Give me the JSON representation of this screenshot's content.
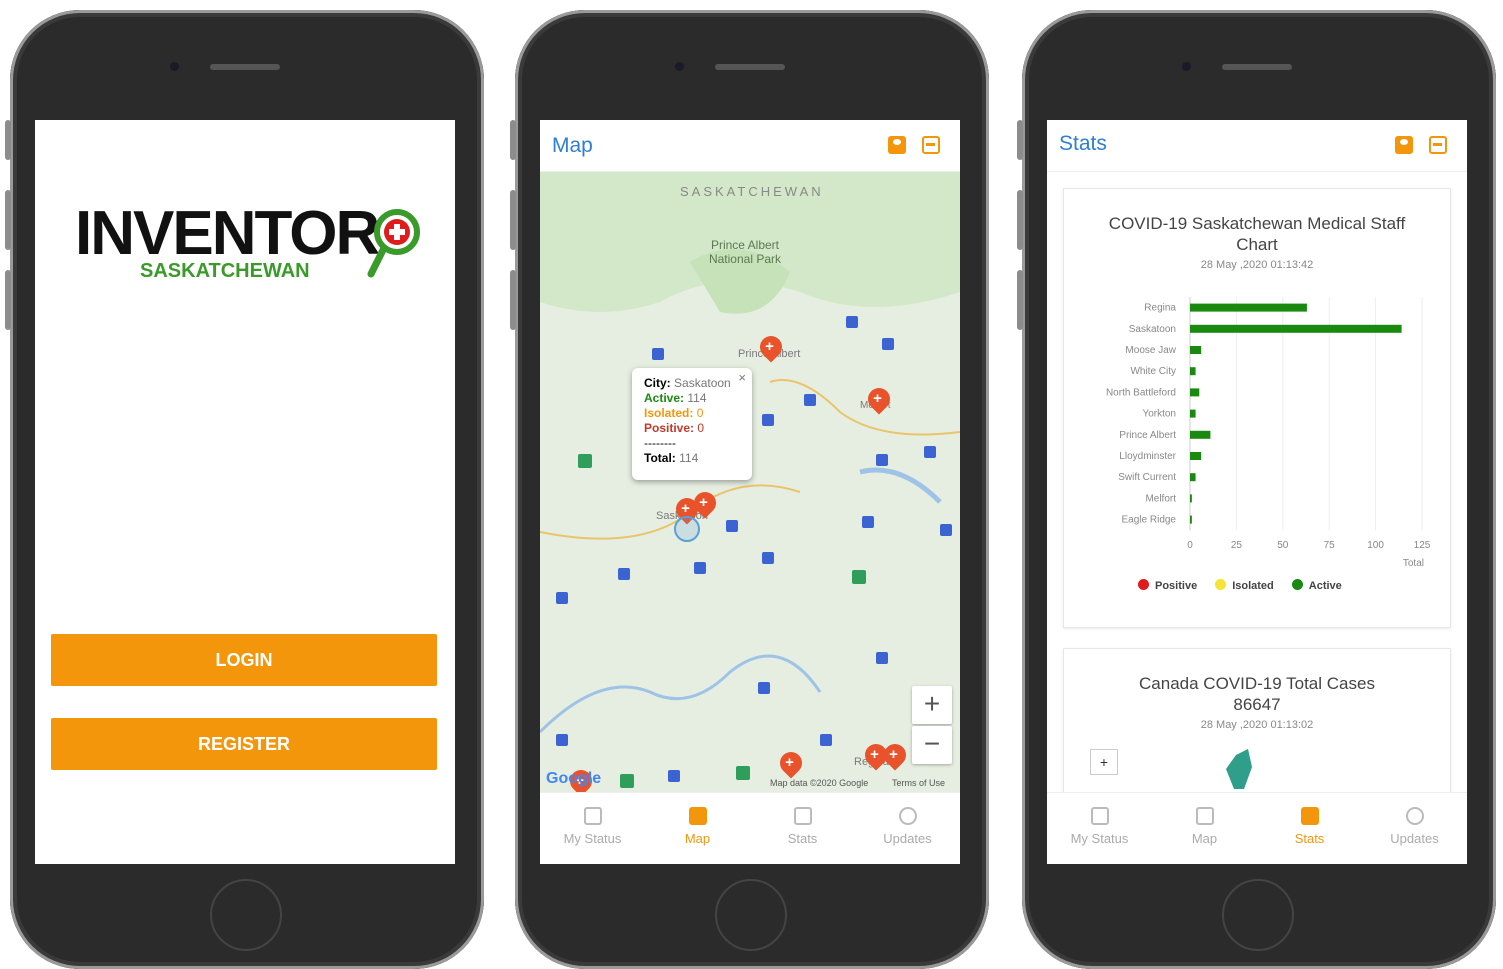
{
  "colors": {
    "accent": "#f4960c",
    "title_blue": "#2f7fd1",
    "positive": "#e01b1b",
    "isolated": "#f5e431",
    "active": "#198a0f"
  },
  "login": {
    "logo_text": "INVENTOR",
    "logo_sub": "SASKATCHEWAN",
    "login_label": "LOGIN",
    "register_label": "REGISTER"
  },
  "map_screen": {
    "title": "Map",
    "labels": {
      "province": "SASKATCHEWAN",
      "park": "Prince Albert National Park",
      "prince_albert": "Prince Albert",
      "saskatoon": "Saskatoon",
      "melfort": "Melfort",
      "regina": "Regina"
    },
    "popup": {
      "city_label": "City:",
      "city": "Saskatoon",
      "active_label": "Active:",
      "active": "114",
      "isolated_label": "Isolated:",
      "isolated": "0",
      "positive_label": "Positive:",
      "positive": "0",
      "divider": "--------",
      "total_label": "Total:",
      "total": "114",
      "close": "×"
    },
    "zoom_in": "+",
    "zoom_out": "−",
    "google": "Google",
    "map_data": "Map data ©2020 Google",
    "terms": "Terms of Use"
  },
  "stats_screen": {
    "title": "Stats",
    "chart_title": "COVID-19 Saskatchewan Medical Staff Chart",
    "chart_date": "28 May ,2020 01:13:42",
    "xlabel": "Total",
    "legend": [
      "Positive",
      "Isolated",
      "Active"
    ],
    "canada_title": "Canada COVID-19 Total Cases",
    "canada_total": "86647",
    "canada_date": "28 May ,2020 01:13:02",
    "map_zoom_in": "+"
  },
  "tabs": [
    {
      "label": "My Status",
      "icon": "plus-square-icon"
    },
    {
      "label": "Map",
      "icon": "map-icon"
    },
    {
      "label": "Stats",
      "icon": "bar-chart-icon"
    },
    {
      "label": "Updates",
      "icon": "refresh-icon"
    }
  ],
  "chart_data": {
    "type": "bar",
    "title": "COVID-19 Saskatchewan Medical Staff Chart",
    "xlabel": "Total",
    "categories": [
      "Regina",
      "Saskatoon",
      "Moose Jaw",
      "White City",
      "North Battleford",
      "Yorkton",
      "Prince Albert",
      "Lloydminster",
      "Swift Current",
      "Melfort",
      "Eagle Ridge"
    ],
    "series": [
      {
        "name": "Positive",
        "values": [
          0,
          0,
          0,
          0,
          0,
          0,
          0,
          0,
          0,
          0,
          0
        ]
      },
      {
        "name": "Isolated",
        "values": [
          0,
          0,
          0,
          0,
          0,
          0,
          0,
          0,
          0,
          0,
          0
        ]
      },
      {
        "name": "Active",
        "values": [
          63,
          114,
          6,
          3,
          5,
          3,
          11,
          6,
          3,
          1,
          1
        ]
      }
    ],
    "xlim": [
      0,
      125
    ],
    "xticks": [
      0,
      25,
      50,
      75,
      100,
      125
    ],
    "orientation": "horizontal",
    "legend_position": "bottom"
  }
}
